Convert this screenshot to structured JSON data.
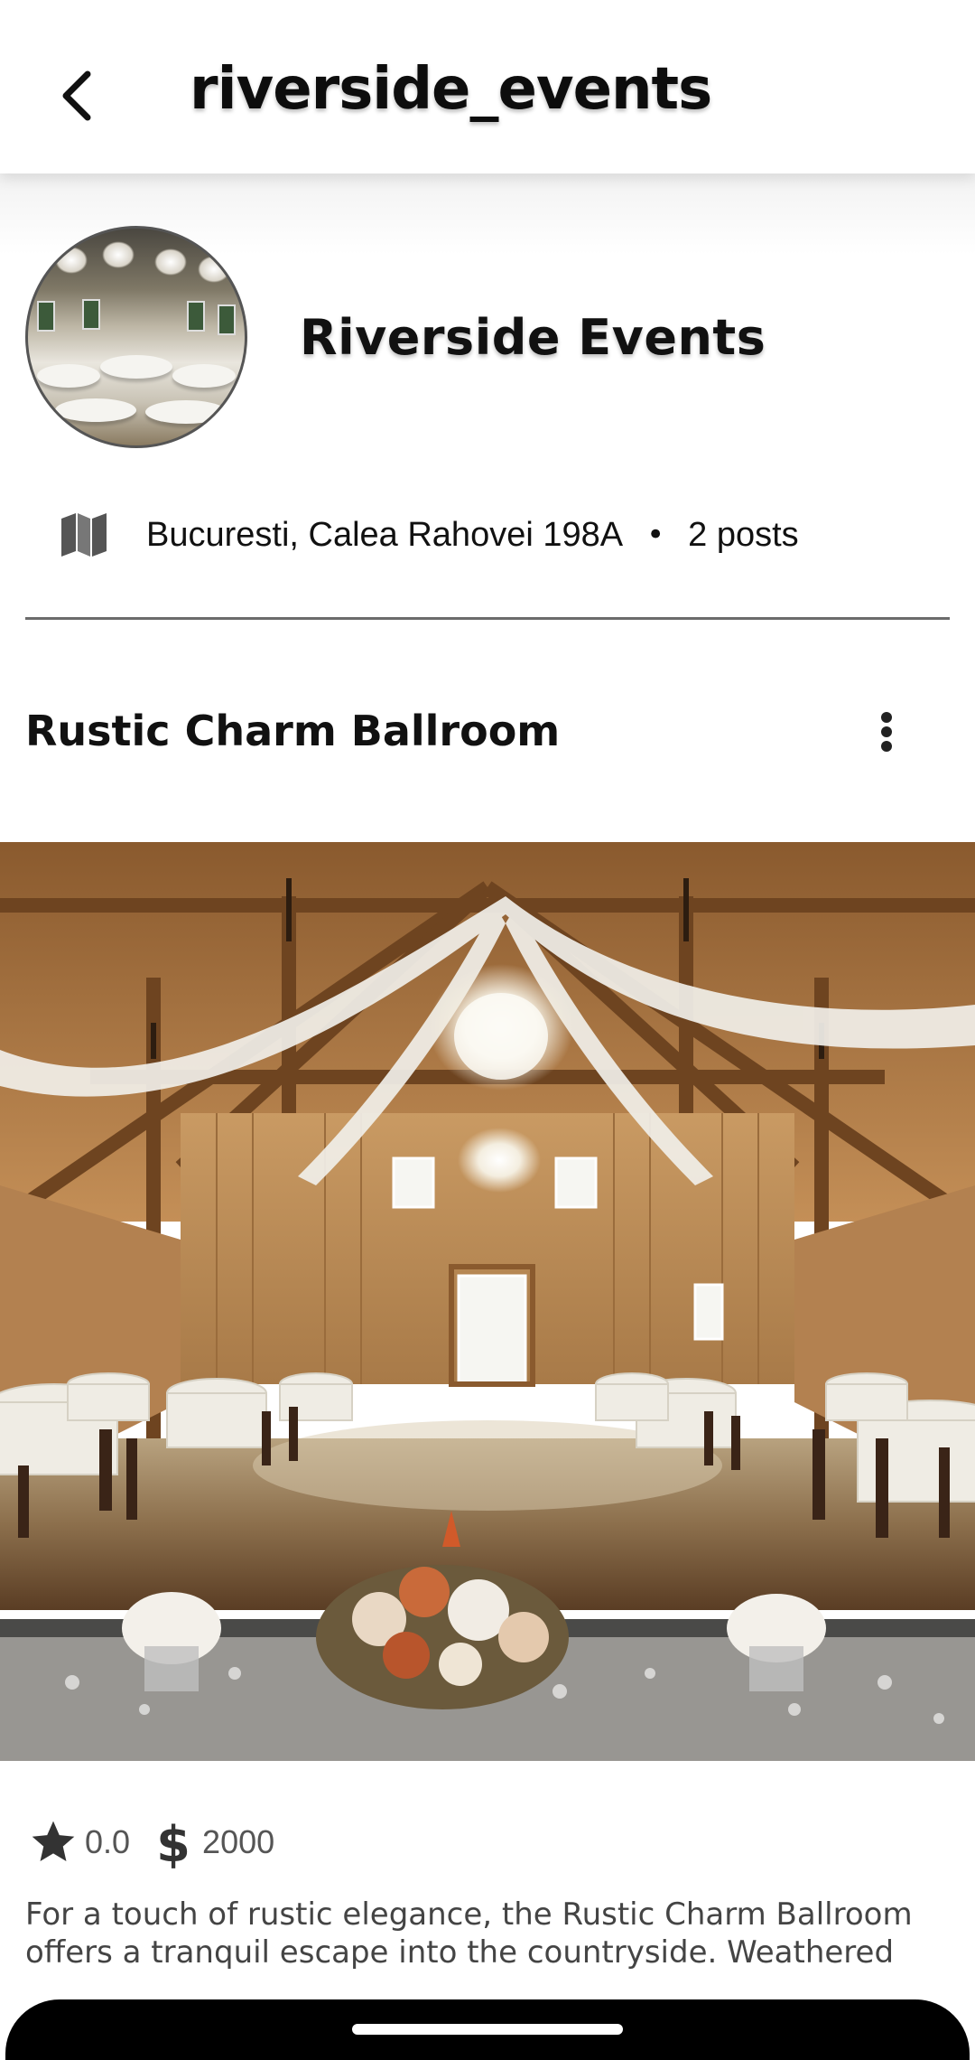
{
  "appbar": {
    "title": "riverside_events",
    "back_icon": "chevron-left-icon"
  },
  "profile": {
    "name": "Riverside Events",
    "address": "Bucuresti, Calea Rahovei 198A",
    "separator": "•",
    "posts": "2 posts",
    "address_icon": "map-icon"
  },
  "post": {
    "title": "Rustic Charm Ballroom",
    "menu_icon": "more-vert-icon",
    "rating": "0.0",
    "price": "2000",
    "rating_icon": "star-icon",
    "price_icon": "dollar-icon",
    "description": "For a touch of rustic elegance, the Rustic Charm Ballroom offers a tranquil escape into the countryside. Weathered"
  },
  "colors": {
    "text": "#111111",
    "muted": "#555555",
    "wood": "#b5804a",
    "navbar": "#000000"
  }
}
